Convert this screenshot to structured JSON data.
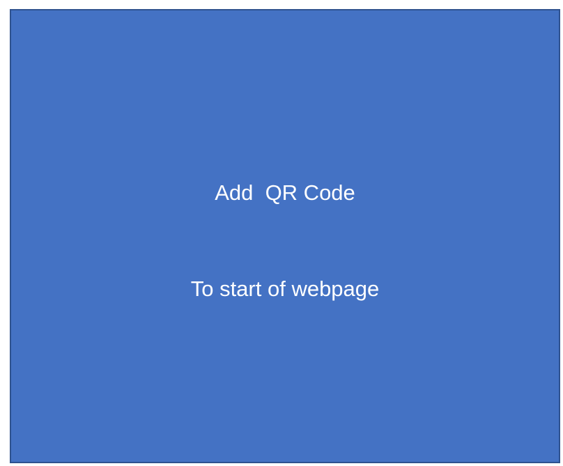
{
  "box": {
    "line1": "Add  QR Code",
    "line2": "To start of webpage",
    "fill_color": "#4472c4",
    "border_color": "#2f528f",
    "text_color": "#ffffff"
  }
}
